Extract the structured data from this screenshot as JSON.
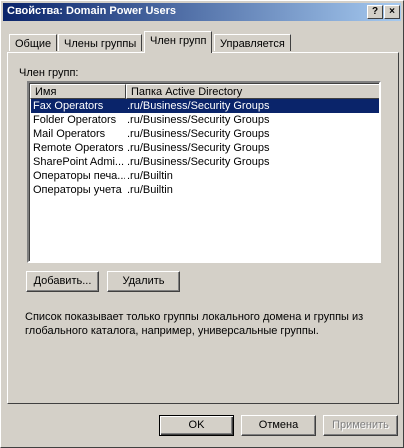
{
  "window": {
    "title": "Свойства: Domain Power Users",
    "help_label": "?",
    "close_label": "×"
  },
  "tabs": [
    {
      "label": "Общие"
    },
    {
      "label": "Члены группы"
    },
    {
      "label": "Член групп"
    },
    {
      "label": "Управляется"
    }
  ],
  "section_label": "Член групп:",
  "list": {
    "columns": [
      "Имя",
      "Папка Active Directory"
    ],
    "rows": [
      {
        "name": "Fax Operators",
        "folder": ".ru/Business/Security Groups"
      },
      {
        "name": "Folder Operators",
        "folder": ".ru/Business/Security Groups"
      },
      {
        "name": "Mail Operators",
        "folder": ".ru/Business/Security Groups"
      },
      {
        "name": "Remote Operators",
        "folder": ".ru/Business/Security Groups"
      },
      {
        "name": "SharePoint Admi...",
        "folder": ".ru/Business/Security Groups"
      },
      {
        "name": "Операторы печа...",
        "folder": ".ru/Builtin"
      },
      {
        "name": "Операторы учета",
        "folder": ".ru/Builtin"
      }
    ]
  },
  "buttons": {
    "add": "Добавить...",
    "remove": "Удалить",
    "ok": "OK",
    "cancel": "Отмена",
    "apply": "Применить"
  },
  "note": "Список показывает только группы локального домена и группы из глобального каталога, например, универсальные группы."
}
